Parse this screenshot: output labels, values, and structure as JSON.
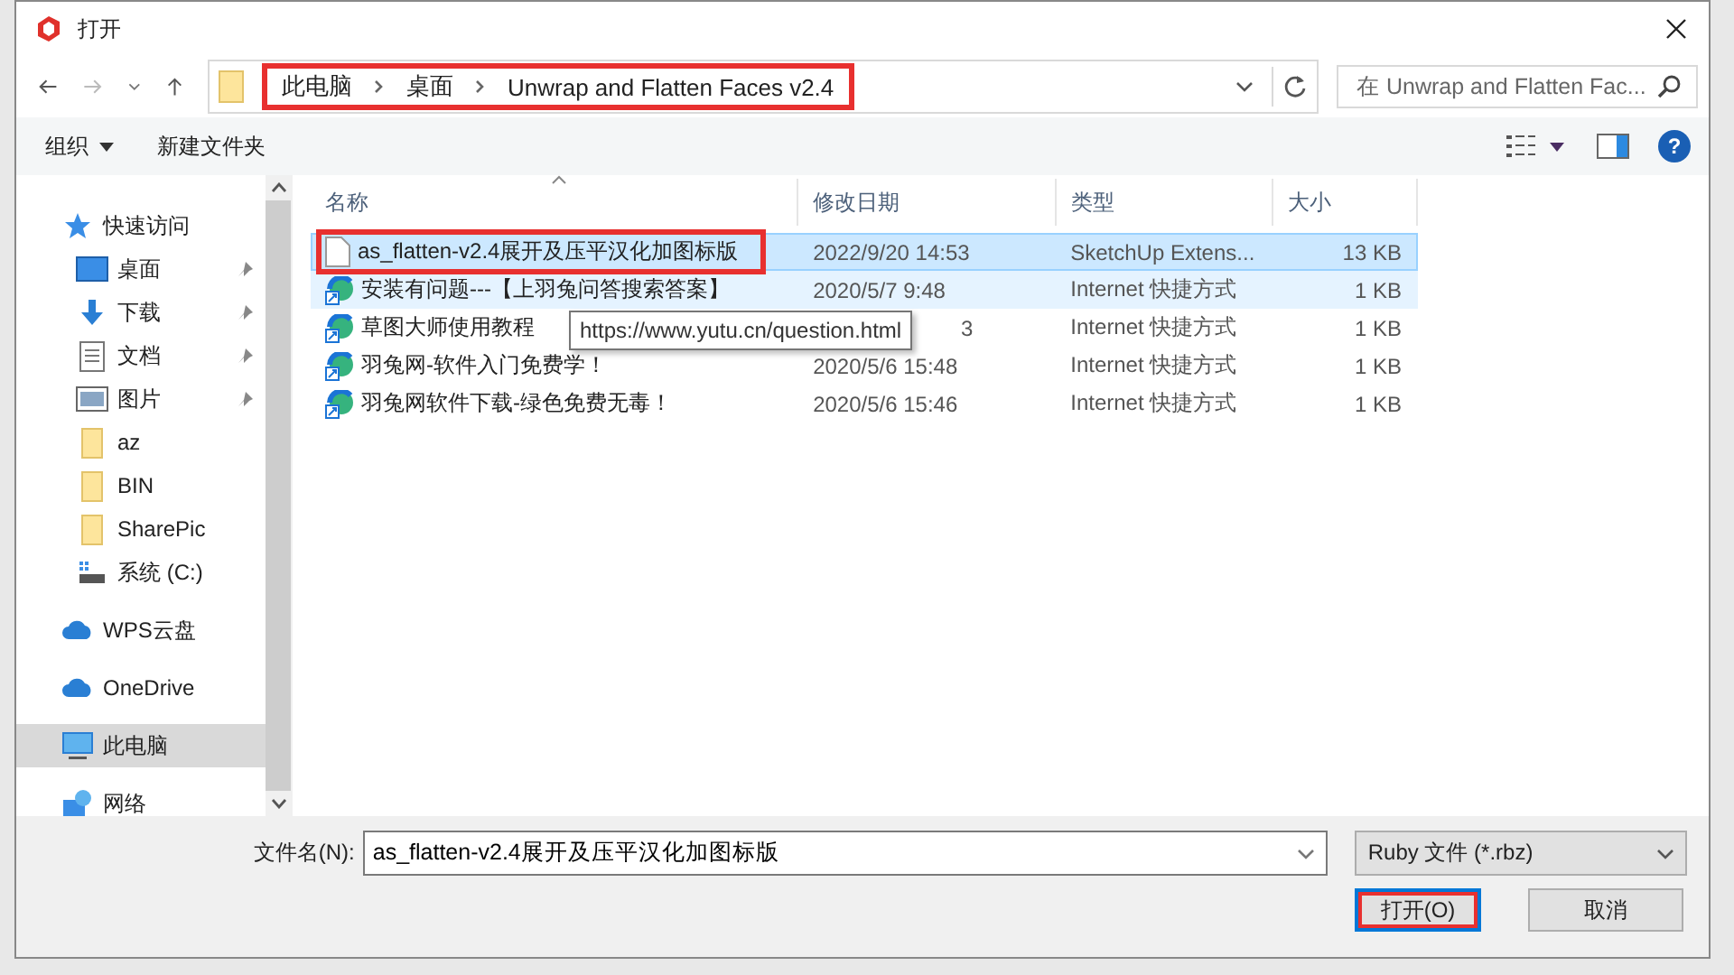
{
  "window": {
    "title": "打开"
  },
  "address": {
    "crumbs": [
      "此电脑",
      "桌面",
      "Unwrap and Flatten Faces v2.4"
    ],
    "highlighted": true
  },
  "search": {
    "placeholder": "在 Unwrap and Flatten Fac..."
  },
  "toolbar": {
    "organize": "组织",
    "new_folder": "新建文件夹",
    "help": "?"
  },
  "sidebar": {
    "items": [
      {
        "label": "快速访问",
        "kind": "star",
        "selected": false,
        "children": [
          {
            "label": "桌面",
            "kind": "desktop",
            "pinned": true,
            "selected": false
          },
          {
            "label": "下载",
            "kind": "download",
            "pinned": true,
            "selected": false
          },
          {
            "label": "文档",
            "kind": "document",
            "pinned": true,
            "selected": false
          },
          {
            "label": "图片",
            "kind": "pictures",
            "pinned": true,
            "selected": false
          },
          {
            "label": "az",
            "kind": "folder",
            "pinned": false,
            "selected": false
          },
          {
            "label": "BIN",
            "kind": "folder",
            "pinned": false,
            "selected": false
          },
          {
            "label": "SharePic",
            "kind": "folder",
            "pinned": false,
            "selected": false
          },
          {
            "label": "系统 (C:)",
            "kind": "drive",
            "pinned": false,
            "selected": false
          }
        ]
      },
      {
        "label": "WPS云盘",
        "kind": "cloud",
        "selected": false
      },
      {
        "label": "OneDrive",
        "kind": "cloud",
        "selected": false
      },
      {
        "label": "此电脑",
        "kind": "computer",
        "selected": true
      },
      {
        "label": "网络",
        "kind": "network",
        "selected": false
      }
    ]
  },
  "table": {
    "columns": [
      "名称",
      "修改日期",
      "类型",
      "大小"
    ],
    "rows": [
      {
        "name": "as_flatten-v2.4展开及压平汉化加图标版",
        "date": "2022/9/20 14:53",
        "type": "SketchUp Extens...",
        "size": "13 KB",
        "kind": "file",
        "selected": true,
        "hovered": false,
        "highlighted": true,
        "date_covered": false
      },
      {
        "name": "安装有问题---【上羽兔问答搜索答案】",
        "date": "2020/5/7 9:48",
        "type": "Internet 快捷方式",
        "size": "1 KB",
        "kind": "shortcut",
        "selected": false,
        "hovered": true,
        "highlighted": false,
        "date_covered": false
      },
      {
        "name": "草图大师使用教程",
        "date": "3",
        "type": "Internet 快捷方式",
        "size": "1 KB",
        "kind": "shortcut",
        "selected": false,
        "hovered": false,
        "highlighted": false,
        "date_covered": true
      },
      {
        "name": "羽兔网-软件入门免费学！",
        "date": "2020/5/6 15:48",
        "type": "Internet 快捷方式",
        "size": "1 KB",
        "kind": "shortcut",
        "selected": false,
        "hovered": false,
        "highlighted": false,
        "date_covered": false
      },
      {
        "name": "羽兔网软件下载-绿色免费无毒！",
        "date": "2020/5/6 15:46",
        "type": "Internet 快捷方式",
        "size": "1 KB",
        "kind": "shortcut",
        "selected": false,
        "hovered": false,
        "highlighted": false,
        "date_covered": false
      }
    ]
  },
  "tooltip": "https://www.yutu.cn/question.html",
  "footer": {
    "filename_label": "文件名(N):",
    "filename": "as_flatten-v2.4展开及压平汉化加图标版",
    "filter": "Ruby 文件 (*.rbz)",
    "open": "打开(O)",
    "open_highlighted": true,
    "cancel": "取消"
  }
}
